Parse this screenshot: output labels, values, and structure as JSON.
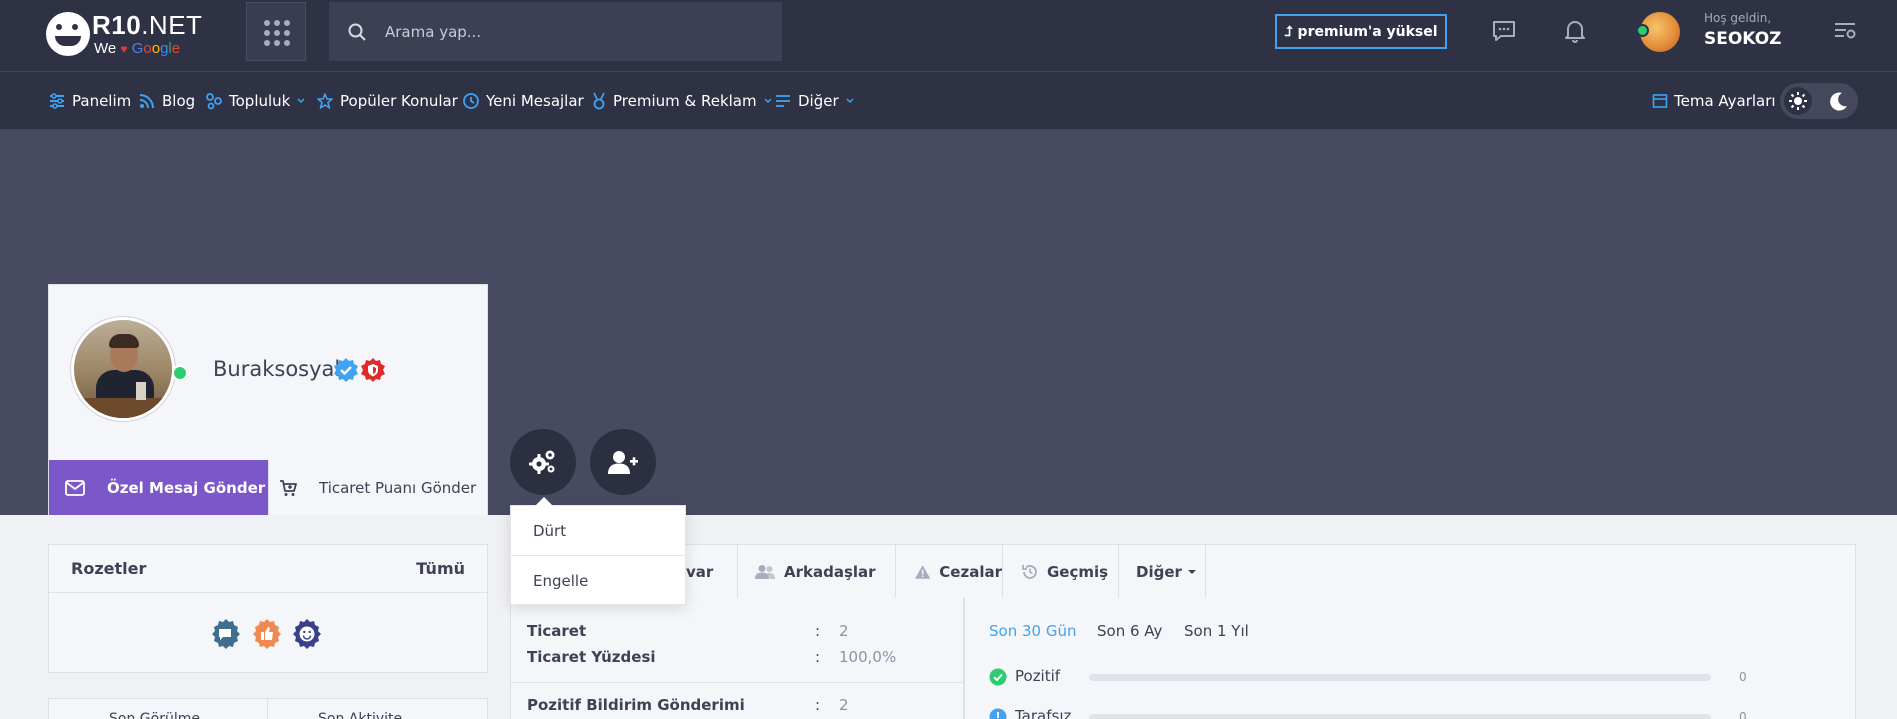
{
  "header": {
    "logo": {
      "name_bold": "R10",
      "name_thin": ".NET",
      "tag_we": "We",
      "tag_google": [
        "G",
        "o",
        "o",
        "g",
        "l",
        "e"
      ]
    },
    "search": {
      "placeholder": "Arama yap..."
    },
    "premium_label": "⮥ premium'a yüksel",
    "user": {
      "welcome": "Hoş geldin,",
      "name": "SEOKOZ"
    }
  },
  "nav": {
    "items": [
      {
        "label": "Panelim"
      },
      {
        "label": "Blog"
      },
      {
        "label": "Topluluk"
      },
      {
        "label": "Popüler Konular"
      },
      {
        "label": "Yeni Mesajlar"
      },
      {
        "label": "Premium & Reklam"
      },
      {
        "label": "Diğer"
      }
    ],
    "theme_label": "Tema Ayarları"
  },
  "profile": {
    "name": "Buraksosyal",
    "pm_label": "Özel Mesaj Gönder",
    "trade_label": "Ticaret Puanı Gönder"
  },
  "dropdown": {
    "items": [
      "Dürt",
      "Engelle"
    ]
  },
  "badges": {
    "title": "Rozetler",
    "all": "Tümü"
  },
  "bottom_tabs": [
    "Son Görülme",
    "Son Aktivite"
  ],
  "tabs": [
    {
      "label": "var"
    },
    {
      "label": "Arkadaşlar"
    },
    {
      "label": "Cezalar"
    },
    {
      "label": "Geçmiş"
    },
    {
      "label": "Diğer"
    }
  ],
  "stats": [
    {
      "label": "Ticaret",
      "value": "2"
    },
    {
      "label": "Ticaret Yüzdesi",
      "value": "100,0%"
    },
    {
      "label": "Pozitif Bildirim Gönderimi",
      "value": "2"
    }
  ],
  "periods": [
    "Son 30 Gün",
    "Son 6 Ay",
    "Son 1 Yıl"
  ],
  "ratings": [
    {
      "label": "Pozitif",
      "count": "0",
      "fill": 0,
      "color": "#2ecc71"
    },
    {
      "label": "Tarafsız",
      "count": "0",
      "fill": 0,
      "color": "#3fa2f2"
    }
  ],
  "colors": {
    "accent": "#3fa2f2",
    "pm_button": "#7b57c9",
    "online": "#2ecc71",
    "header_bg": "#2f3245",
    "cover_bg": "#474a61"
  }
}
